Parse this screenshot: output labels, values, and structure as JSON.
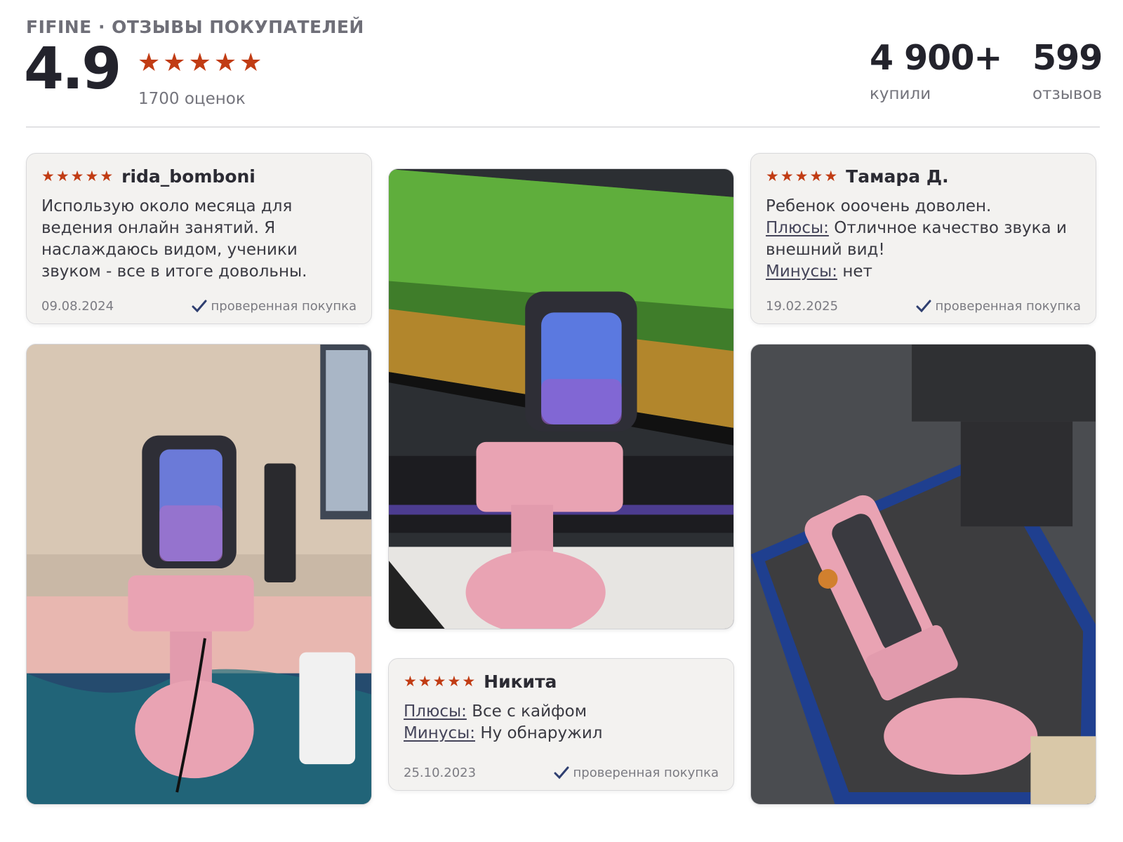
{
  "header": {
    "kicker": "FIFINE · ОТЗЫВЫ ПОКУПАТЕЛЕЙ",
    "rating": "4.9",
    "rating_stars": 5,
    "ratings_count": "1700 оценок",
    "bought_value": "4 900+",
    "bought_label": "купили",
    "reviews_value": "599",
    "reviews_label": "отзывов"
  },
  "reviews": [
    {
      "author": "rida_bomboni",
      "stars": 5,
      "text": "Использую около месяца для ведения онлайн занятий. Я наслаждаюсь видом, ученики звуком - все в итоге довольны.",
      "date": "09.08.2024",
      "verified": "проверенная покупка"
    },
    {
      "author": "Тамара Д.",
      "stars": 5,
      "line1": "Ребенок ооочень доволен.",
      "pros_label": "Плюсы:",
      "pros": "Отличное качество звука и внешний вид!",
      "cons_label": "Минусы:",
      "cons": "нет",
      "date": "19.02.2025",
      "verified": "проверенная покупка"
    },
    {
      "author": "Никита",
      "stars": 5,
      "pros_label": "Плюсы:",
      "pros": "Все с кайфом",
      "cons_label": "Минусы:",
      "cons": "Ну обнаружил",
      "date": "25.10.2023",
      "verified": "проверенная покупка"
    }
  ],
  "colors": {
    "star": "#c13c14",
    "card_bg": "#f3f2f0",
    "mic_pink": "#e9a3b3",
    "check": "#2f3f70"
  },
  "icons": {
    "star": "star-icon",
    "verified": "checkmark-icon"
  }
}
